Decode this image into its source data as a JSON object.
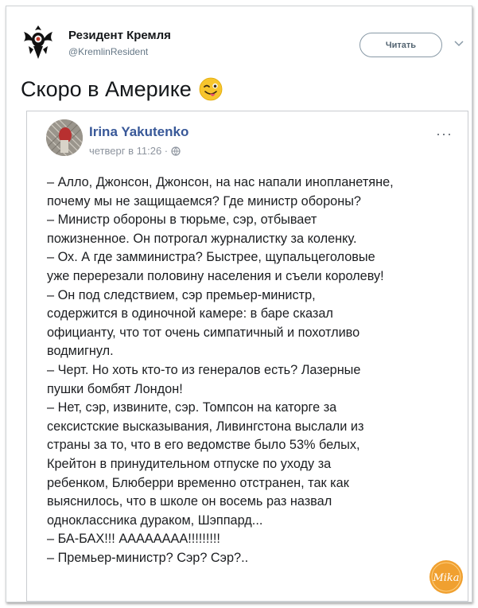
{
  "tweet": {
    "author_name": "Резидент Кремля",
    "author_handle": "@KremlinResident",
    "follow_label": "Читать",
    "text": "Скоро в Америке",
    "emoji": "winking-face-with-tongue"
  },
  "post": {
    "author": "Irina Yakutenko",
    "time": "четверг в 11:26 ·",
    "visibility_icon": "globe-icon",
    "more": "···",
    "lines": [
      "– Алло, Джонсон, Джонсон, на нас напали инопланетяне,",
      "почему мы не защищаемся? Где министр обороны?",
      "– Министр обороны в тюрьме, сэр, отбывает",
      "пожизненное. Он потрогал журналистку за коленку.",
      "– Ох. А где замминистра? Быстрее, щупальцеголовые",
      "уже перерезали половину населения и съели королеву!",
      "– Он под следствием, сэр премьер-министр,",
      "содержится в одиночной камере: в баре сказал",
      "официанту, что тот очень симпатичный и похотливо",
      "водмигнул.",
      "– Черт. Но хоть кто-то из генералов есть? Лазерные",
      "пушки бомбят Лондон!",
      "– Нет, сэр, извините, сэр. Томпсон на каторге за",
      "сексистские высказывания, Ливингстона выслали из",
      "страны за то, что в его ведомстве было 53% белых,",
      "Крейтон в принудительном отпуске по уходу за",
      "ребенком, Блюберри временно отстранен, так как",
      "выяснилось, что в школе он восемь раз назвал",
      "одноклассника дураком, Шэппард...",
      "– БА-БАХ!!! АААААААА!!!!!!!!!",
      "– Премьер-министр? Сэр? Сэр?.."
    ]
  },
  "watermark": {
    "text": "Mika",
    "color": "#f0a030"
  }
}
